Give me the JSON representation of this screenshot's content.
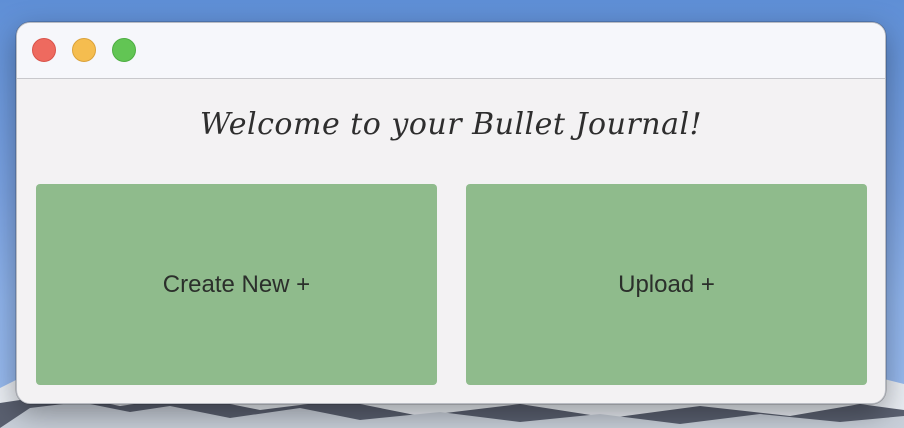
{
  "window": {
    "title_controls": {
      "close": "close-button",
      "minimize": "minimize-button",
      "zoom": "zoom-button"
    },
    "colors": {
      "close": "#ee6a5f",
      "minimize": "#f5bd4f",
      "zoom": "#62c554",
      "tile": "#8fbb8c",
      "background": "#f3f2f3"
    }
  },
  "main": {
    "heading": "Welcome to your Bullet Journal!",
    "create_label": "Create New +",
    "upload_label": "Upload +"
  }
}
